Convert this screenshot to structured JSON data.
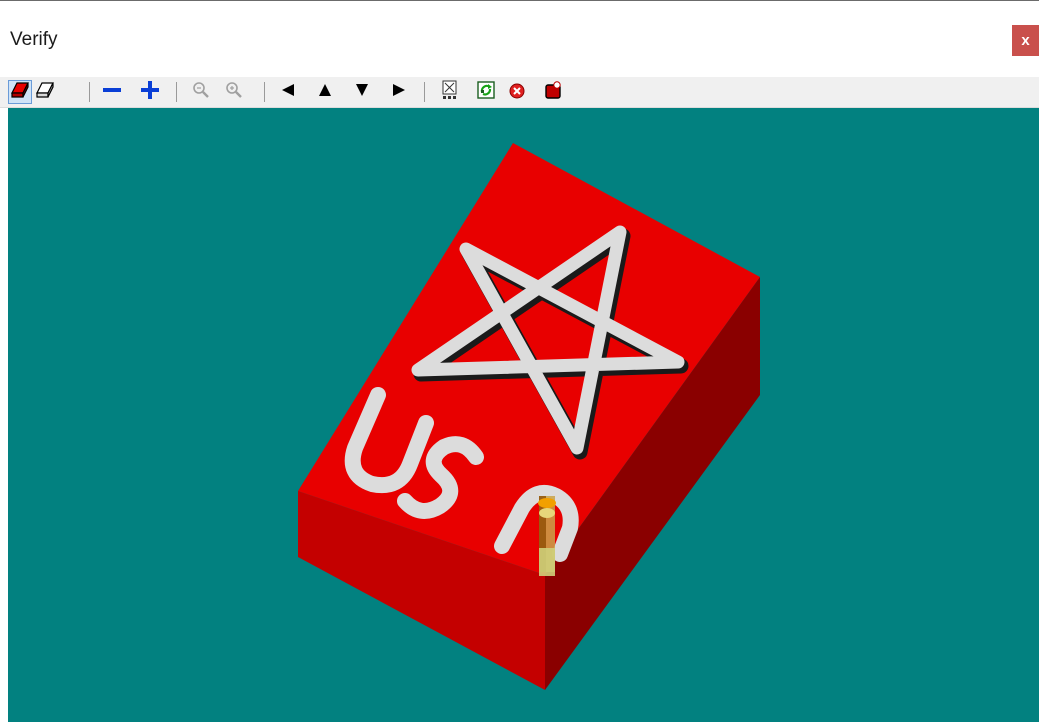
{
  "window": {
    "title": "Verify",
    "close_label": "x"
  },
  "toolbar": {
    "buttons": [
      {
        "name": "shaded-solid-view-button",
        "icon": "solid-block-icon"
      },
      {
        "name": "wireframe-view-button",
        "icon": "outline-block-icon"
      },
      {
        "name": "slower-button",
        "icon": "minus-icon"
      },
      {
        "name": "faster-button",
        "icon": "plus-icon"
      },
      {
        "name": "zoom-in-button",
        "icon": "magnifier-icon"
      },
      {
        "name": "zoom-out-button",
        "icon": "magnifier-icon"
      },
      {
        "name": "rotate-left-button",
        "icon": "triangle-left-icon"
      },
      {
        "name": "rotate-up-button",
        "icon": "triangle-up-icon"
      },
      {
        "name": "rotate-down-button",
        "icon": "triangle-down-icon"
      },
      {
        "name": "rotate-right-button",
        "icon": "triangle-right-icon"
      },
      {
        "name": "fit-view-button",
        "icon": "fit-box-icon"
      },
      {
        "name": "refresh-button",
        "icon": "refresh-icon"
      },
      {
        "name": "stop-button",
        "icon": "stop-circle-icon"
      },
      {
        "name": "record-button",
        "icon": "record-block-icon"
      }
    ]
  },
  "viewport": {
    "background": "#028180",
    "stock_top_color": "#e80000",
    "stock_left_color": "#c40000",
    "stock_right_color": "#8a0000",
    "engraving_color": "#dcdcdc",
    "engraved_text": "USA",
    "engraved_shape": "star"
  }
}
